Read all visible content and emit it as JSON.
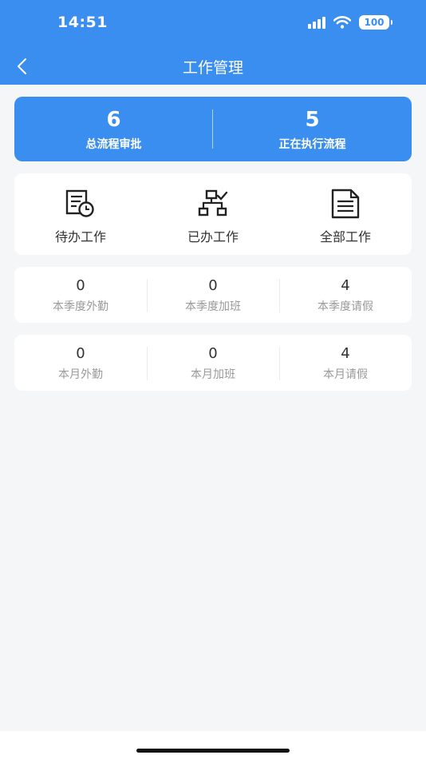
{
  "status_bar": {
    "time": "14:51",
    "battery": "100"
  },
  "header": {
    "title": "工作管理"
  },
  "summary": [
    {
      "value": "6",
      "label": "总流程审批"
    },
    {
      "value": "5",
      "label": "正在执行流程"
    }
  ],
  "work_items": [
    {
      "label": "待办工作",
      "icon": "pending-work-icon"
    },
    {
      "label": "已办工作",
      "icon": "done-work-icon"
    },
    {
      "label": "全部工作",
      "icon": "all-work-icon"
    }
  ],
  "quarter_stats": [
    {
      "value": "0",
      "label": "本季度外勤"
    },
    {
      "value": "0",
      "label": "本季度加班"
    },
    {
      "value": "4",
      "label": "本季度请假"
    }
  ],
  "month_stats": [
    {
      "value": "0",
      "label": "本月外勤"
    },
    {
      "value": "0",
      "label": "本月加班"
    },
    {
      "value": "4",
      "label": "本月请假"
    }
  ],
  "colors": {
    "primary": "#3a8ef0",
    "background": "#f5f6f8",
    "card": "#ffffff"
  }
}
